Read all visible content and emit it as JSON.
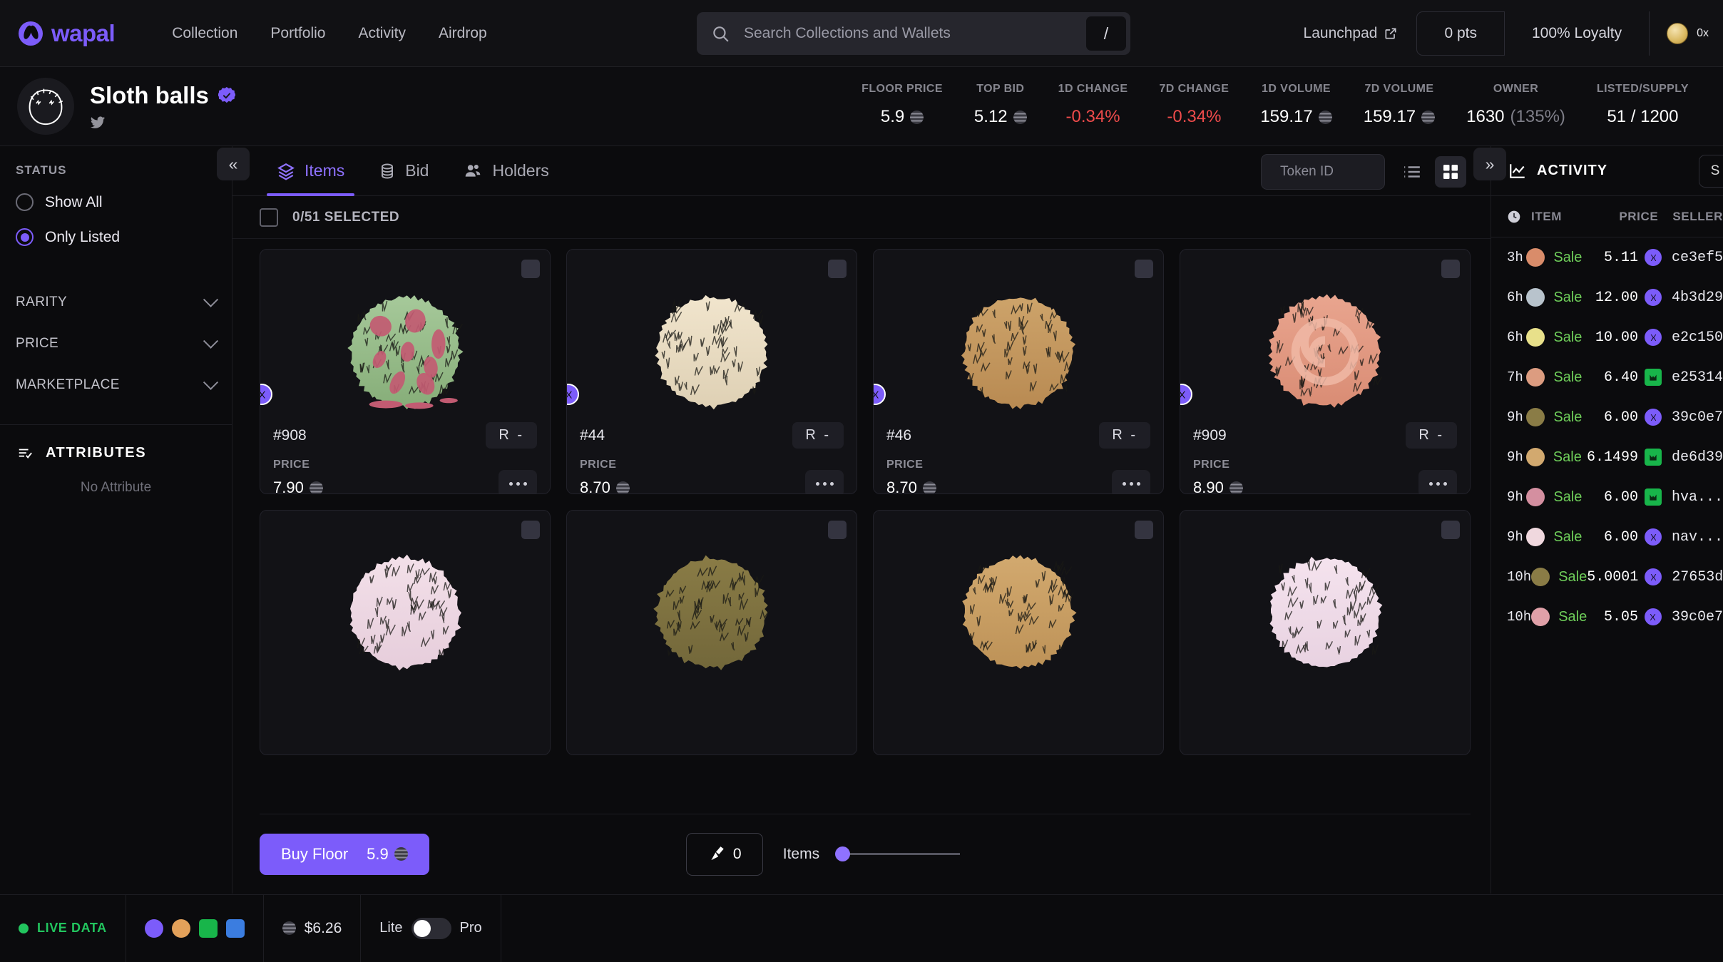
{
  "nav": {
    "brand": "wapal",
    "links": [
      "Collection",
      "Portfolio",
      "Activity",
      "Airdrop"
    ],
    "search_placeholder": "Search Collections and Wallets",
    "search_value": "",
    "slash_hint": "/",
    "launchpad": "Launchpad",
    "points": "0 pts",
    "loyalty": "100% Loyalty",
    "wallet": "0x"
  },
  "collection": {
    "name": "Sloth balls",
    "verified": true,
    "stats": [
      {
        "label": "FLOOR PRICE",
        "value": "5.9",
        "unit": "aptos",
        "tone": "normal"
      },
      {
        "label": "TOP BID",
        "value": "5.12",
        "unit": "aptos",
        "tone": "normal"
      },
      {
        "label": "1D CHANGE",
        "value": "-0.34%",
        "unit": "",
        "tone": "negative"
      },
      {
        "label": "7D CHANGE",
        "value": "-0.34%",
        "unit": "",
        "tone": "negative"
      },
      {
        "label": "1D VOLUME",
        "value": "159.17",
        "unit": "aptos",
        "tone": "normal"
      },
      {
        "label": "7D VOLUME",
        "value": "159.17",
        "unit": "aptos",
        "tone": "normal"
      },
      {
        "label": "OWNER",
        "value": "1630",
        "sub": "(135%)",
        "unit": "",
        "tone": "normal"
      },
      {
        "label": "LISTED/SUPPLY",
        "value": "51 / 1200",
        "unit": "",
        "tone": "normal"
      }
    ]
  },
  "sidebar": {
    "status_title": "STATUS",
    "status_options": [
      {
        "label": "Show All",
        "selected": false
      },
      {
        "label": "Only Listed",
        "selected": true
      }
    ],
    "accordions": [
      "RARITY",
      "PRICE",
      "MARKETPLACE"
    ],
    "attributes_title": "ATTRIBUTES",
    "attributes_empty": "No Attribute"
  },
  "main": {
    "collapse_icon": "«",
    "expand_icon": "»",
    "tabs": [
      {
        "label": "Items",
        "icon": "layers-icon",
        "active": true
      },
      {
        "label": "Bid",
        "icon": "database-icon",
        "active": false
      },
      {
        "label": "Holders",
        "icon": "people-icon",
        "active": false
      }
    ],
    "token_search_placeholder": "Token ID",
    "token_search_value": "",
    "selection_label": "0/51 SELECTED",
    "cards": [
      {
        "id": "#908",
        "rarity": "R  -",
        "price_label": "PRICE",
        "price": "7.90",
        "color_a": "#a6c99a",
        "color_b": "#86ad78",
        "variant": "bloody"
      },
      {
        "id": "#44",
        "rarity": "R  -",
        "price_label": "PRICE",
        "price": "8.70",
        "color_a": "#f1e5cd",
        "color_b": "#ded0b4",
        "variant": "plain"
      },
      {
        "id": "#46",
        "rarity": "R  -",
        "price_label": "PRICE",
        "price": "8.70",
        "color_a": "#cda36a",
        "color_b": "#b88a52",
        "variant": "plain"
      },
      {
        "id": "#909",
        "rarity": "R  -",
        "price_label": "PRICE",
        "price": "8.90",
        "color_a": "#e9a58f",
        "color_b": "#d98c74",
        "variant": "swirl"
      }
    ],
    "cards_row2": [
      {
        "color_a": "#f3e0e9",
        "color_b": "#e6cddb"
      },
      {
        "color_a": "#8a7c46",
        "color_b": "#72673a"
      },
      {
        "color_a": "#d2a96f",
        "color_b": "#bd9257"
      },
      {
        "color_a": "#f5e3ee",
        "color_b": "#e8d2e1"
      }
    ],
    "buy_floor_label": "Buy Floor",
    "buy_floor_price": "5.9",
    "sweep_count": "0",
    "items_label": "Items"
  },
  "activity": {
    "title": "ACTIVITY",
    "filter_icon": "S",
    "columns": [
      "ITEM",
      "PRICE",
      "SELLER"
    ],
    "rows": [
      {
        "time": "3h",
        "kind": "Sale",
        "price": "5.11",
        "market": "wapal",
        "seller": "ce3ef5",
        "thumb": "#d98c6a"
      },
      {
        "time": "6h",
        "kind": "Sale",
        "price": "12.00",
        "market": "wapal",
        "seller": "4b3d29",
        "thumb": "#b8c3cc"
      },
      {
        "time": "6h",
        "kind": "Sale",
        "price": "10.00",
        "market": "wapal",
        "seller": "e2c150",
        "thumb": "#e8e08a"
      },
      {
        "time": "7h",
        "kind": "Sale",
        "price": "6.40",
        "market": "green",
        "seller": "e25314",
        "thumb": "#dc9c80"
      },
      {
        "time": "9h",
        "kind": "Sale",
        "price": "6.00",
        "market": "wapal",
        "seller": "39c0e7",
        "thumb": "#8a7c46"
      },
      {
        "time": "9h",
        "kind": "Sale",
        "price": "6.1499",
        "market": "green",
        "seller": "de6d39",
        "thumb": "#d2a96f"
      },
      {
        "time": "9h",
        "kind": "Sale",
        "price": "6.00",
        "market": "green",
        "seller": "hva...",
        "thumb": "#d48fa0"
      },
      {
        "time": "9h",
        "kind": "Sale",
        "price": "6.00",
        "market": "wapal",
        "seller": "nav...",
        "thumb": "#f0d8de"
      },
      {
        "time": "10h",
        "kind": "Sale",
        "price": "5.0001",
        "market": "wapal",
        "seller": "27653d",
        "thumb": "#8a7c46"
      },
      {
        "time": "10h",
        "kind": "Sale",
        "price": "5.05",
        "market": "wapal",
        "seller": "39c0e7",
        "thumb": "#e0a0a8"
      }
    ]
  },
  "statusbar": {
    "live_label": "LIVE DATA",
    "apt_price": "$6.26",
    "lite_label": "Lite",
    "pro_label": "Pro"
  },
  "colors": {
    "accent": "#7c5cfa",
    "negative": "#ef4b4b",
    "positive": "#6fcf5a",
    "background": "#0b0b0d"
  }
}
